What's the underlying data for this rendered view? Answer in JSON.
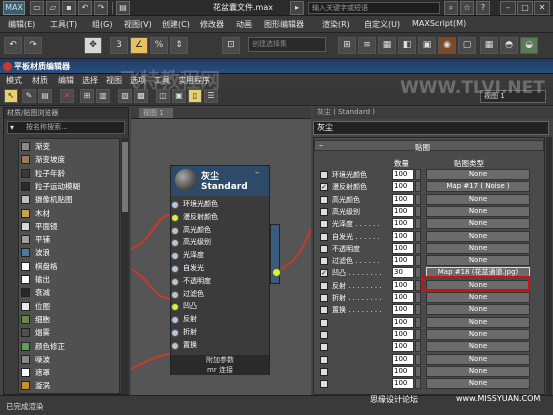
{
  "titlebar": {
    "logo": "MAX",
    "document": "花盆囊文件.max",
    "search_placeholder": "输入关键字或短语",
    "help_icon": "?",
    "min_label": "–",
    "max_label": "□",
    "close_label": "✕"
  },
  "main_menu": [
    "编辑(E)",
    "工具(T)",
    "组(G)",
    "视图(V)",
    "创建(C)",
    "修改器",
    "动画",
    "图形编辑器",
    "渲染(R)",
    "自定义(U)",
    "MAXScript(M)"
  ],
  "main_toolbar": {
    "selection_set_placeholder": "创建选择集",
    "buttons": [
      "↶",
      "↷",
      "3",
      "∠",
      "%",
      "⇕",
      "⊡",
      "⊞",
      "≡",
      "▦",
      "◧",
      "▣",
      "◉",
      "▢"
    ]
  },
  "slate": {
    "title": "平板材质编辑器",
    "menu": [
      "模式",
      "材质",
      "编辑",
      "选择",
      "视图",
      "选项",
      "工具",
      "实用程序"
    ],
    "view_select": "视图 1",
    "browser": {
      "header": "材质/贴图浏览器",
      "search_placeholder": "按名称搜索...",
      "items": [
        {
          "label": "渐变",
          "swatch": "#8a8a8a"
        },
        {
          "label": "渐变坡度",
          "swatch": "#9a7a5a"
        },
        {
          "label": "粒子年龄",
          "swatch": "#3a3a3a"
        },
        {
          "label": "粒子运动模糊",
          "swatch": "#2a2a2a"
        },
        {
          "label": "摄像机贴图",
          "swatch": "#c0c0c0"
        },
        {
          "label": "木材",
          "swatch": "#c8a050"
        },
        {
          "label": "平面镜",
          "swatch": "#d8d8d8"
        },
        {
          "label": "平铺",
          "swatch": "#a0a0a0"
        },
        {
          "label": "波浪",
          "swatch": "#4a7aa0"
        },
        {
          "label": "棋盘格",
          "swatch": "#ffffff"
        },
        {
          "label": "输出",
          "swatch": "#ffffff"
        },
        {
          "label": "衰减",
          "swatch": "#2a2a2a"
        },
        {
          "label": "位图",
          "swatch": "#e8e8e8"
        },
        {
          "label": "细胞",
          "swatch": "#6a8a4a"
        },
        {
          "label": "烟雾",
          "swatch": "#505050"
        },
        {
          "label": "颜色修正",
          "swatch": "#5aa05a"
        },
        {
          "label": "噪波",
          "swatch": "#8a8a8a"
        },
        {
          "label": "遮罩",
          "swatch": "#ffffff"
        },
        {
          "label": "漩涡",
          "swatch": "#c89030"
        }
      ]
    },
    "view_tab": "视图 1",
    "node": {
      "name": "灰尘",
      "type": "Standard",
      "min_label": "–",
      "slots": [
        {
          "label": "环境光颜色",
          "active": false
        },
        {
          "label": "漫反射颜色",
          "active": true
        },
        {
          "label": "高光颜色",
          "active": false
        },
        {
          "label": "高光级别",
          "active": false
        },
        {
          "label": "光泽度",
          "active": false
        },
        {
          "label": "自发光",
          "active": false
        },
        {
          "label": "不透明度",
          "active": false
        },
        {
          "label": "过滤色",
          "active": false
        },
        {
          "label": "凹凸",
          "active": true
        },
        {
          "label": "反射",
          "active": false
        },
        {
          "label": "折射",
          "active": false
        },
        {
          "label": "置换",
          "active": false
        }
      ],
      "footer1": "附加参数",
      "footer2": "mr 连接"
    },
    "params": {
      "header": "灰尘 ( Standard )",
      "material_name": "灰尘",
      "rollout_toggle": "–",
      "rollout_title": "贴图",
      "col_amount": "数量",
      "col_maptype": "贴图类型",
      "rows": [
        {
          "label": "环境光颜色",
          "checked": false,
          "amount": "100",
          "map": "None",
          "selected": false
        },
        {
          "label": "漫反射颜色",
          "checked": true,
          "amount": "100",
          "map": "Map #17 ( Noise )",
          "selected": false
        },
        {
          "label": "高光颜色",
          "checked": false,
          "amount": "100",
          "map": "None",
          "selected": false
        },
        {
          "label": "高光级别",
          "checked": false,
          "amount": "100",
          "map": "None",
          "selected": false
        },
        {
          "label": "光泽度 . . . . . .",
          "checked": false,
          "amount": "100",
          "map": "None",
          "selected": false
        },
        {
          "label": "自发光 . . . . . .",
          "checked": false,
          "amount": "100",
          "map": "None",
          "selected": false
        },
        {
          "label": "不透明度",
          "checked": false,
          "amount": "100",
          "map": "None",
          "selected": false
        },
        {
          "label": "过滤色 . . . . . .",
          "checked": false,
          "amount": "100",
          "map": "None",
          "selected": false
        },
        {
          "label": "凹凸 . . . . . . . .",
          "checked": true,
          "amount": "30",
          "map": "Map #18 (花盆通道.jpg)",
          "selected": true
        },
        {
          "label": "反射 . . . . . . . .",
          "checked": false,
          "amount": "100",
          "map": "None",
          "selected": false
        },
        {
          "label": "折射 . . . . . . . .",
          "checked": false,
          "amount": "100",
          "map": "None",
          "selected": false
        },
        {
          "label": "置换 . . . . . . . .",
          "checked": false,
          "amount": "100",
          "map": "None",
          "selected": false
        },
        {
          "label": "",
          "checked": false,
          "amount": "100",
          "map": "None",
          "selected": false
        },
        {
          "label": "",
          "checked": false,
          "amount": "100",
          "map": "None",
          "selected": false
        },
        {
          "label": "",
          "checked": false,
          "amount": "100",
          "map": "None",
          "selected": false
        },
        {
          "label": "",
          "checked": false,
          "amount": "100",
          "map": "None",
          "selected": false
        },
        {
          "label": "",
          "checked": false,
          "amount": "100",
          "map": "None",
          "selected": false
        },
        {
          "label": "",
          "checked": false,
          "amount": "100",
          "map": "None",
          "selected": false
        }
      ]
    },
    "status": "已完成渲染"
  },
  "watermark": {
    "center": "飞特教程网",
    "right": "WWW.TLVI.NET",
    "bottom_left": "思缘设计论坛",
    "bottom_right": "www.MISSYUAN.COM"
  },
  "colors": {
    "node_header": "#2d4a69",
    "active_slot": "#d6f23a",
    "wire": "#c83a2a",
    "highlight": "#d01010"
  }
}
